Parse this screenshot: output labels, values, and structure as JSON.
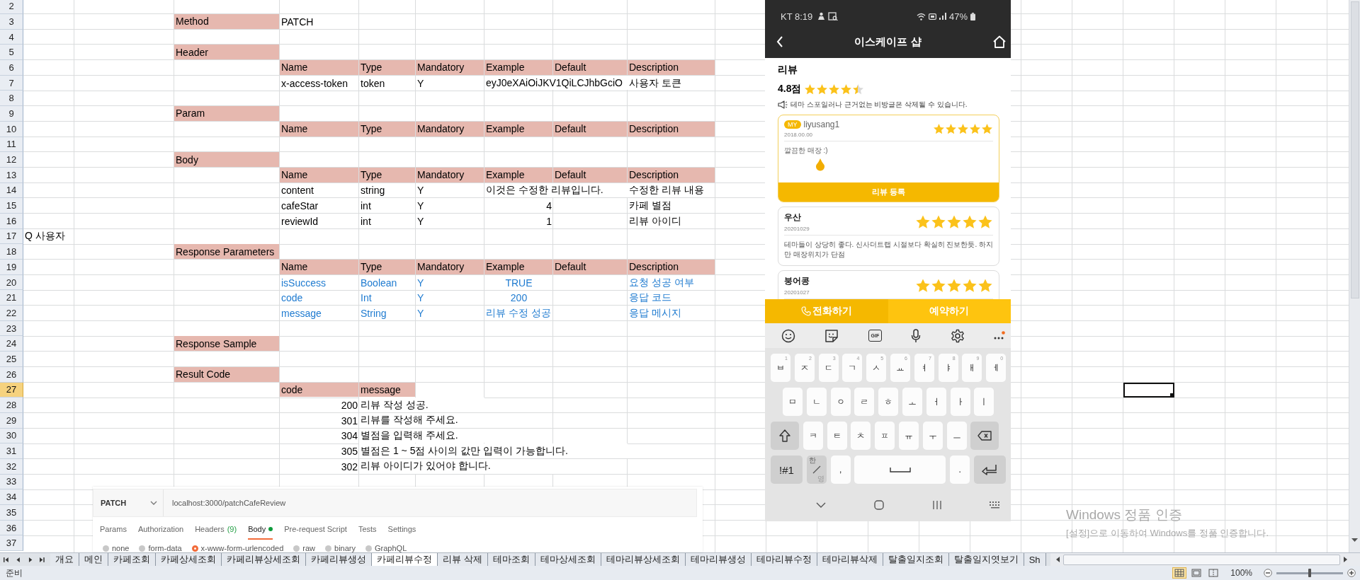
{
  "sheet": {
    "rows": [
      {
        "number": "2",
        "selected": false
      },
      {
        "number": "3",
        "selected": false,
        "cells": [
          null,
          null,
          {
            "text": "Method",
            "highlight": true
          },
          "PATCH"
        ]
      },
      {
        "number": "4",
        "selected": false
      },
      {
        "number": "5",
        "selected": false,
        "cells": [
          null,
          null,
          {
            "text": "Header",
            "highlight": true
          }
        ]
      },
      {
        "number": "6",
        "selected": false,
        "cells": [
          null,
          null,
          null,
          {
            "text": "Name",
            "highlight": true
          },
          {
            "text": "Type",
            "highlight": true
          },
          {
            "text": "Mandatory",
            "highlight": true
          },
          {
            "text": "Example",
            "highlight": true
          },
          {
            "text": "Default",
            "highlight": true
          },
          {
            "text": "Description",
            "highlight": true
          }
        ]
      },
      {
        "number": "7",
        "selected": false,
        "cells": [
          null,
          null,
          null,
          "x-access-token",
          "token",
          "Y",
          "eyJ0eXAiOiJKV1QiLCJhbGciO",
          null,
          "사용자 토큰"
        ]
      },
      {
        "number": "8",
        "selected": false
      },
      {
        "number": "9",
        "selected": false,
        "cells": [
          null,
          null,
          {
            "text": "Param",
            "highlight": true
          }
        ]
      },
      {
        "number": "10",
        "selected": false,
        "cells": [
          null,
          null,
          null,
          {
            "text": "Name",
            "highlight": true
          },
          {
            "text": "Type",
            "highlight": true
          },
          {
            "text": "Mandatory",
            "highlight": true
          },
          {
            "text": "Example",
            "highlight": true
          },
          {
            "text": "Default",
            "highlight": true
          },
          {
            "text": "Description",
            "highlight": true
          }
        ]
      },
      {
        "number": "11",
        "selected": false
      },
      {
        "number": "12",
        "selected": false,
        "cells": [
          null,
          null,
          {
            "text": "Body",
            "highlight": true
          }
        ]
      },
      {
        "number": "13",
        "selected": false,
        "cells": [
          null,
          null,
          null,
          {
            "text": "Name",
            "highlight": true
          },
          {
            "text": "Type",
            "highlight": true
          },
          {
            "text": "Mandatory",
            "highlight": true
          },
          {
            "text": "Example",
            "highlight": true
          },
          {
            "text": "Default",
            "highlight": true
          },
          {
            "text": "Description",
            "highlight": true
          }
        ]
      },
      {
        "number": "14",
        "selected": false,
        "cells": [
          null,
          null,
          null,
          "content",
          "string",
          "Y",
          "이것은 수정한 리뷰입니다.",
          null,
          "수정한 리뷰 내용"
        ]
      },
      {
        "number": "15",
        "selected": false,
        "cells": [
          null,
          null,
          null,
          "cafeStar",
          "int",
          "Y",
          {
            "text": "4",
            "kind": "number"
          },
          null,
          "카페 별점"
        ]
      },
      {
        "number": "16",
        "selected": false,
        "cells": [
          null,
          null,
          null,
          "reviewId",
          "int",
          "Y",
          {
            "text": "1",
            "kind": "number"
          },
          null,
          "리뷰 아이디"
        ]
      },
      {
        "number": "17",
        "selected": false,
        "cells": [
          "Q 사용자"
        ]
      },
      {
        "number": "18",
        "selected": false,
        "cells": [
          null,
          null,
          {
            "text": "Response Parameters",
            "highlight": true
          }
        ]
      },
      {
        "number": "19",
        "selected": false,
        "cells": [
          null,
          null,
          null,
          {
            "text": "Name",
            "highlight": true
          },
          {
            "text": "Type",
            "highlight": true
          },
          {
            "text": "Mandatory",
            "highlight": true
          },
          {
            "text": "Example",
            "highlight": true
          },
          {
            "text": "Default",
            "highlight": true
          },
          {
            "text": "Description",
            "highlight": true
          }
        ]
      },
      {
        "number": "20",
        "selected": false,
        "color": "#1f7bd0",
        "cells": [
          null,
          null,
          null,
          "isSuccess",
          "Boolean",
          "Y",
          {
            "text": "TRUE",
            "kind": "centered"
          },
          null,
          "요청 성공 여부"
        ]
      },
      {
        "number": "21",
        "selected": false,
        "color": "#1f7bd0",
        "cells": [
          null,
          null,
          null,
          "code",
          "Int",
          "Y",
          {
            "text": "200",
            "kind": "centered"
          },
          null,
          "응답 코드"
        ]
      },
      {
        "number": "22",
        "selected": false,
        "color": "#1f7bd0",
        "cells": [
          null,
          null,
          null,
          "message",
          "String",
          "Y",
          "리뷰 수정 성공",
          null,
          "응답 메시지"
        ]
      },
      {
        "number": "23",
        "selected": false
      },
      {
        "number": "24",
        "selected": false,
        "cells": [
          null,
          null,
          {
            "text": "Response Sample",
            "highlight": true
          }
        ]
      },
      {
        "number": "25",
        "selected": false
      },
      {
        "number": "26",
        "selected": false,
        "cells": [
          null,
          null,
          {
            "text": "Result Code",
            "highlight": true
          }
        ]
      },
      {
        "number": "27",
        "selected": true,
        "cells": [
          null,
          null,
          null,
          {
            "text": "code",
            "highlight": true
          },
          {
            "text": "message",
            "highlight": true
          },
          null,
          null,
          null,
          null,
          null,
          null,
          null,
          null,
          null,
          null,
          null,
          null,
          {
            "selected": true
          }
        ]
      },
      {
        "number": "28",
        "selected": false,
        "cells": [
          null,
          null,
          null,
          {
            "text": "200",
            "kind": "number"
          },
          "리뷰 작성 성공."
        ]
      },
      {
        "number": "29",
        "selected": false,
        "cells": [
          null,
          null,
          null,
          {
            "text": "301",
            "kind": "number"
          },
          "리뷰를 작성해 주세요."
        ]
      },
      {
        "number": "30",
        "selected": false,
        "cells": [
          null,
          null,
          null,
          {
            "text": "304",
            "kind": "number"
          },
          "별점을 입력해 주세요."
        ]
      },
      {
        "number": "31",
        "selected": false,
        "cells": [
          null,
          null,
          null,
          {
            "text": "305",
            "kind": "number"
          },
          "별점은 1 ~ 5점 사이의 값만 입력이 가능합니다."
        ]
      },
      {
        "number": "32",
        "selected": false,
        "cells": [
          null,
          null,
          null,
          {
            "text": "302",
            "kind": "number"
          },
          "리뷰 아이디가 있어야 합니다."
        ]
      },
      {
        "number": "33",
        "selected": false
      },
      {
        "number": "34",
        "selected": false
      },
      {
        "number": "35",
        "selected": false
      },
      {
        "number": "36",
        "selected": false
      },
      {
        "number": "37",
        "selected": false
      }
    ]
  },
  "postman": {
    "method": "PATCH",
    "url": "localhost:3000/patchCafeReview",
    "tabs": [
      {
        "label": "Params",
        "selected": false,
        "modified": false
      },
      {
        "label": "Authorization",
        "selected": false,
        "modified": false
      },
      {
        "label": "Headers",
        "count": "(9)",
        "selected": false,
        "modified": false
      },
      {
        "label": "Body",
        "selected": true,
        "modified": true
      },
      {
        "label": "Pre-request Script",
        "selected": false,
        "modified": false
      },
      {
        "label": "Tests",
        "selected": false,
        "modified": false
      },
      {
        "label": "Settings",
        "selected": false,
        "modified": false
      }
    ],
    "body_types": [
      {
        "label": "none",
        "selected": false
      },
      {
        "label": "form-data",
        "selected": false
      },
      {
        "label": "x-www-form-urlencoded",
        "selected": true
      },
      {
        "label": "raw",
        "selected": false
      },
      {
        "label": "binary",
        "selected": false
      },
      {
        "label": "GraphQL",
        "selected": false
      }
    ]
  },
  "phone": {
    "status": {
      "carrier_time": "KT 8:19",
      "battery": "47%"
    },
    "title": "이스케이프 샵",
    "section_title": "리뷰",
    "rating": "4.8점",
    "stars": 4.5,
    "notice": "테마 스포일러나 근거없는 비방글은 삭제될 수 있습니다.",
    "my_review": {
      "badge": "MY",
      "user": "liyusang1",
      "date": "2018.00.00",
      "stars": 5,
      "text": "깔끔한 매장 :)",
      "submit": "리뷰 등록"
    },
    "reviews": [
      {
        "user": "우산",
        "date": "20201029",
        "stars": 5,
        "text": "테마들이 상당히 좋다. 신사더트랩 시절보다 확실히 진보한듯. 하지만 매장위치가 단점"
      },
      {
        "user": "붕어콩",
        "date": "20201027",
        "stars": 5
      }
    ],
    "actions": [
      {
        "label": "전화하기",
        "kind": "call"
      },
      {
        "label": "예약하기",
        "kind": "reserve"
      }
    ],
    "keyboard": {
      "gif": "GIF",
      "rows": [
        [
          {
            "label": "ㅂ",
            "hint": "1"
          },
          {
            "label": "ㅈ",
            "hint": "2"
          },
          {
            "label": "ㄷ",
            "hint": "3"
          },
          {
            "label": "ㄱ",
            "hint": "4"
          },
          {
            "label": "ㅅ",
            "hint": "5"
          },
          {
            "label": "ㅛ",
            "hint": "6"
          },
          {
            "label": "ㅕ",
            "hint": "7"
          },
          {
            "label": "ㅑ",
            "hint": "8"
          },
          {
            "label": "ㅐ",
            "hint": "9"
          },
          {
            "label": "ㅔ",
            "hint": "0"
          }
        ],
        [
          {
            "label": "ㅁ"
          },
          {
            "label": "ㄴ"
          },
          {
            "label": "ㅇ"
          },
          {
            "label": "ㄹ"
          },
          {
            "label": "ㅎ"
          },
          {
            "label": "ㅗ"
          },
          {
            "label": "ㅓ"
          },
          {
            "label": "ㅏ"
          },
          {
            "label": "ㅣ"
          }
        ],
        [
          {
            "kind": "shift"
          },
          {
            "label": "ㅋ"
          },
          {
            "label": "ㅌ"
          },
          {
            "label": "ㅊ"
          },
          {
            "label": "ㅍ"
          },
          {
            "label": "ㅠ"
          },
          {
            "label": "ㅜ"
          },
          {
            "label": "ㅡ"
          },
          {
            "kind": "backspace"
          }
        ],
        [
          {
            "kind": "function",
            "label": "!#1"
          },
          {
            "kind": "lang",
            "label": "한",
            "sub": "영"
          },
          {
            "label": ","
          },
          {
            "kind": "space"
          },
          {
            "label": "."
          },
          {
            "kind": "enter"
          }
        ]
      ]
    }
  },
  "notice": {
    "title": "Windows 정품 인증",
    "text": "[설정]으로 이동하여 Windows를 정품 인증합니다."
  },
  "sheet_tabs": [
    {
      "label": "개요",
      "selected": false
    },
    {
      "label": "메인",
      "selected": false
    },
    {
      "label": "카페조회",
      "selected": false
    },
    {
      "label": "카페상세조회",
      "selected": false
    },
    {
      "label": "카페리뷰상세조회",
      "selected": false
    },
    {
      "label": "카페리뷰생성",
      "selected": false
    },
    {
      "label": "카페리뷰수정",
      "selected": true
    },
    {
      "label": "리뷰 삭제",
      "selected": false
    },
    {
      "label": "테마조회",
      "selected": false
    },
    {
      "label": "테마상세조회",
      "selected": false
    },
    {
      "label": "테마리뷰상세조회",
      "selected": false
    },
    {
      "label": "테마리뷰생성",
      "selected": false
    },
    {
      "label": "테마리뷰수정",
      "selected": false
    },
    {
      "label": "테마리뷰삭제",
      "selected": false
    },
    {
      "label": "탈출일지조회",
      "selected": false
    },
    {
      "label": "탈출일지엿보기",
      "selected": false
    },
    {
      "label": "Sh",
      "selected": false
    }
  ],
  "status_bar": {
    "text": "준비",
    "views": [
      {
        "kind": "normal",
        "selected": true
      },
      {
        "kind": "page-layout",
        "selected": false
      },
      {
        "kind": "page-break",
        "selected": false
      }
    ],
    "zoom": "100%",
    "zoom_slider": {
      "level": 0.5
    }
  }
}
